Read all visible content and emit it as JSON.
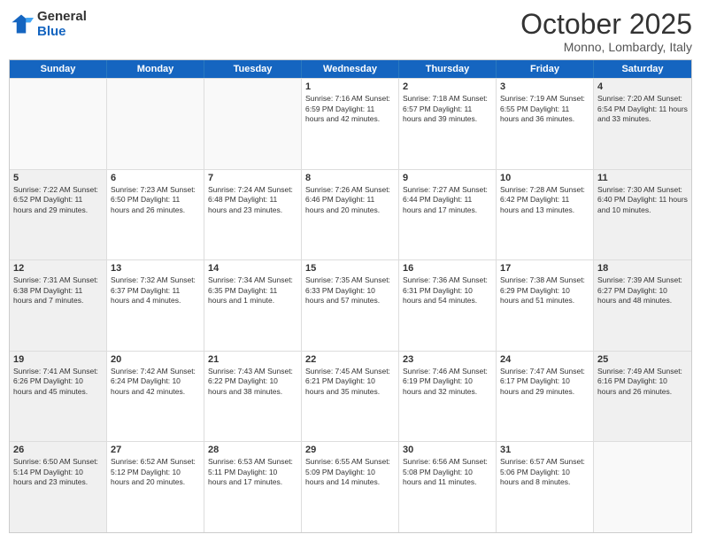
{
  "header": {
    "logo_line1": "General",
    "logo_line2": "Blue",
    "month_title": "October 2025",
    "location": "Monno, Lombardy, Italy"
  },
  "weekdays": [
    "Sunday",
    "Monday",
    "Tuesday",
    "Wednesday",
    "Thursday",
    "Friday",
    "Saturday"
  ],
  "rows": [
    [
      {
        "day": "",
        "info": "",
        "empty": true
      },
      {
        "day": "",
        "info": "",
        "empty": true
      },
      {
        "day": "",
        "info": "",
        "empty": true
      },
      {
        "day": "1",
        "info": "Sunrise: 7:16 AM\nSunset: 6:59 PM\nDaylight: 11 hours\nand 42 minutes.",
        "empty": false
      },
      {
        "day": "2",
        "info": "Sunrise: 7:18 AM\nSunset: 6:57 PM\nDaylight: 11 hours\nand 39 minutes.",
        "empty": false
      },
      {
        "day": "3",
        "info": "Sunrise: 7:19 AM\nSunset: 6:55 PM\nDaylight: 11 hours\nand 36 minutes.",
        "empty": false
      },
      {
        "day": "4",
        "info": "Sunrise: 7:20 AM\nSunset: 6:54 PM\nDaylight: 11 hours\nand 33 minutes.",
        "empty": false,
        "shaded": true
      }
    ],
    [
      {
        "day": "5",
        "info": "Sunrise: 7:22 AM\nSunset: 6:52 PM\nDaylight: 11 hours\nand 29 minutes.",
        "empty": false,
        "shaded": true
      },
      {
        "day": "6",
        "info": "Sunrise: 7:23 AM\nSunset: 6:50 PM\nDaylight: 11 hours\nand 26 minutes.",
        "empty": false
      },
      {
        "day": "7",
        "info": "Sunrise: 7:24 AM\nSunset: 6:48 PM\nDaylight: 11 hours\nand 23 minutes.",
        "empty": false
      },
      {
        "day": "8",
        "info": "Sunrise: 7:26 AM\nSunset: 6:46 PM\nDaylight: 11 hours\nand 20 minutes.",
        "empty": false
      },
      {
        "day": "9",
        "info": "Sunrise: 7:27 AM\nSunset: 6:44 PM\nDaylight: 11 hours\nand 17 minutes.",
        "empty": false
      },
      {
        "day": "10",
        "info": "Sunrise: 7:28 AM\nSunset: 6:42 PM\nDaylight: 11 hours\nand 13 minutes.",
        "empty": false
      },
      {
        "day": "11",
        "info": "Sunrise: 7:30 AM\nSunset: 6:40 PM\nDaylight: 11 hours\nand 10 minutes.",
        "empty": false,
        "shaded": true
      }
    ],
    [
      {
        "day": "12",
        "info": "Sunrise: 7:31 AM\nSunset: 6:38 PM\nDaylight: 11 hours\nand 7 minutes.",
        "empty": false,
        "shaded": true
      },
      {
        "day": "13",
        "info": "Sunrise: 7:32 AM\nSunset: 6:37 PM\nDaylight: 11 hours\nand 4 minutes.",
        "empty": false
      },
      {
        "day": "14",
        "info": "Sunrise: 7:34 AM\nSunset: 6:35 PM\nDaylight: 11 hours\nand 1 minute.",
        "empty": false
      },
      {
        "day": "15",
        "info": "Sunrise: 7:35 AM\nSunset: 6:33 PM\nDaylight: 10 hours\nand 57 minutes.",
        "empty": false
      },
      {
        "day": "16",
        "info": "Sunrise: 7:36 AM\nSunset: 6:31 PM\nDaylight: 10 hours\nand 54 minutes.",
        "empty": false
      },
      {
        "day": "17",
        "info": "Sunrise: 7:38 AM\nSunset: 6:29 PM\nDaylight: 10 hours\nand 51 minutes.",
        "empty": false
      },
      {
        "day": "18",
        "info": "Sunrise: 7:39 AM\nSunset: 6:27 PM\nDaylight: 10 hours\nand 48 minutes.",
        "empty": false,
        "shaded": true
      }
    ],
    [
      {
        "day": "19",
        "info": "Sunrise: 7:41 AM\nSunset: 6:26 PM\nDaylight: 10 hours\nand 45 minutes.",
        "empty": false,
        "shaded": true
      },
      {
        "day": "20",
        "info": "Sunrise: 7:42 AM\nSunset: 6:24 PM\nDaylight: 10 hours\nand 42 minutes.",
        "empty": false
      },
      {
        "day": "21",
        "info": "Sunrise: 7:43 AM\nSunset: 6:22 PM\nDaylight: 10 hours\nand 38 minutes.",
        "empty": false
      },
      {
        "day": "22",
        "info": "Sunrise: 7:45 AM\nSunset: 6:21 PM\nDaylight: 10 hours\nand 35 minutes.",
        "empty": false
      },
      {
        "day": "23",
        "info": "Sunrise: 7:46 AM\nSunset: 6:19 PM\nDaylight: 10 hours\nand 32 minutes.",
        "empty": false
      },
      {
        "day": "24",
        "info": "Sunrise: 7:47 AM\nSunset: 6:17 PM\nDaylight: 10 hours\nand 29 minutes.",
        "empty": false
      },
      {
        "day": "25",
        "info": "Sunrise: 7:49 AM\nSunset: 6:16 PM\nDaylight: 10 hours\nand 26 minutes.",
        "empty": false,
        "shaded": true
      }
    ],
    [
      {
        "day": "26",
        "info": "Sunrise: 6:50 AM\nSunset: 5:14 PM\nDaylight: 10 hours\nand 23 minutes.",
        "empty": false,
        "shaded": true
      },
      {
        "day": "27",
        "info": "Sunrise: 6:52 AM\nSunset: 5:12 PM\nDaylight: 10 hours\nand 20 minutes.",
        "empty": false
      },
      {
        "day": "28",
        "info": "Sunrise: 6:53 AM\nSunset: 5:11 PM\nDaylight: 10 hours\nand 17 minutes.",
        "empty": false
      },
      {
        "day": "29",
        "info": "Sunrise: 6:55 AM\nSunset: 5:09 PM\nDaylight: 10 hours\nand 14 minutes.",
        "empty": false
      },
      {
        "day": "30",
        "info": "Sunrise: 6:56 AM\nSunset: 5:08 PM\nDaylight: 10 hours\nand 11 minutes.",
        "empty": false
      },
      {
        "day": "31",
        "info": "Sunrise: 6:57 AM\nSunset: 5:06 PM\nDaylight: 10 hours\nand 8 minutes.",
        "empty": false
      },
      {
        "day": "",
        "info": "",
        "empty": true
      }
    ]
  ]
}
